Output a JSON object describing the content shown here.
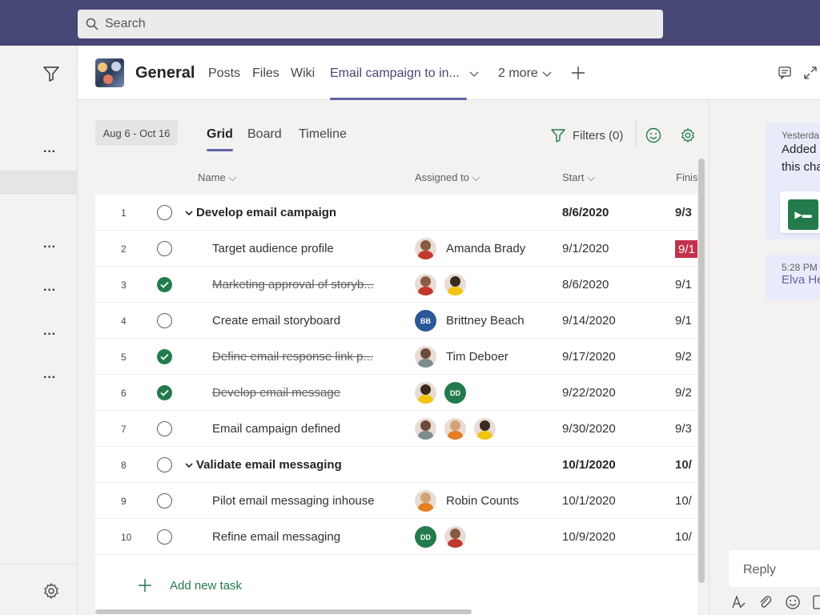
{
  "search": {
    "placeholder": "Search"
  },
  "channel": {
    "name": "General",
    "tabs": [
      "Posts",
      "Files",
      "Wiki",
      "Email campaign to in...",
      "2 more"
    ],
    "active_tab_index": 3
  },
  "planner": {
    "date_range": "Aug 6 - Oct 16",
    "views": [
      "Grid",
      "Board",
      "Timeline"
    ],
    "active_view": "Grid",
    "filters_label": "Filters (0)",
    "columns": {
      "name": "Name",
      "assigned": "Assigned to",
      "start": "Start",
      "finish": "Finis"
    },
    "tasks": [
      {
        "num": "1",
        "status": "open",
        "name": "Develop email campaign",
        "group": true,
        "start": "8/6/2020",
        "finish": "9/3",
        "assignees": []
      },
      {
        "num": "2",
        "status": "open",
        "name": "Target audience profile",
        "group": false,
        "start": "9/1/2020",
        "finish": "9/1",
        "late": true,
        "assignees": [
          {
            "type": "photo",
            "style": "p1"
          }
        ],
        "assignee_name": "Amanda Brady"
      },
      {
        "num": "3",
        "status": "done",
        "name": "Marketing approval of storyb...",
        "group": false,
        "start": "8/6/2020",
        "finish": "9/1",
        "assignees": [
          {
            "type": "photo",
            "style": "p1"
          },
          {
            "type": "photo",
            "style": "p2"
          }
        ]
      },
      {
        "num": "4",
        "status": "open",
        "name": "Create email storyboard",
        "group": false,
        "start": "9/14/2020",
        "finish": "9/1",
        "assignees": [
          {
            "type": "initials",
            "text": "BB",
            "color": "#2b5797"
          }
        ],
        "assignee_name": "Brittney Beach"
      },
      {
        "num": "5",
        "status": "done",
        "name": "Define email response link p...",
        "group": false,
        "start": "9/17/2020",
        "finish": "9/2",
        "assignees": [
          {
            "type": "photo",
            "style": "p3"
          }
        ],
        "assignee_name": "Tim Deboer"
      },
      {
        "num": "6",
        "status": "done",
        "name": "Develop email message",
        "group": false,
        "start": "9/22/2020",
        "finish": "9/2",
        "assignees": [
          {
            "type": "photo",
            "style": "p2"
          },
          {
            "type": "initials",
            "text": "DD",
            "color": "#237b4b"
          }
        ]
      },
      {
        "num": "7",
        "status": "open",
        "name": "Email campaign defined",
        "group": false,
        "start": "9/30/2020",
        "finish": "9/3",
        "assignees": [
          {
            "type": "photo",
            "style": "p3"
          },
          {
            "type": "photo",
            "style": "p4"
          },
          {
            "type": "photo",
            "style": "p2"
          }
        ]
      },
      {
        "num": "8",
        "status": "open",
        "name": "Validate email messaging",
        "group": true,
        "start": "10/1/2020",
        "finish": "10/",
        "assignees": []
      },
      {
        "num": "9",
        "status": "open",
        "name": "Pilot email messaging inhouse",
        "group": false,
        "start": "10/1/2020",
        "finish": "10/",
        "assignees": [
          {
            "type": "photo",
            "style": "p4"
          }
        ],
        "assignee_name": "Robin Counts"
      },
      {
        "num": "10",
        "status": "open",
        "name": "Refine email messaging",
        "group": false,
        "start": "10/9/2020",
        "finish": "10/",
        "assignees": [
          {
            "type": "initials",
            "text": "DD",
            "color": "#237b4b"
          },
          {
            "type": "photo",
            "style": "p1"
          }
        ]
      }
    ],
    "add_task_label": "Add new task"
  },
  "chat": {
    "msg1_time": "Yesterda",
    "msg1_line1": "Added",
    "msg1_line2": "this cha",
    "msg2_time": "5:28 PM",
    "msg2_name": "Elva He",
    "reply_placeholder": "Reply"
  },
  "colors": {
    "brand": "#464775",
    "accent": "#6264a7",
    "done_green": "#237b4b",
    "late_red": "#c4314b"
  },
  "icons": [
    "search-icon",
    "filter-icon",
    "more-icon",
    "gear-icon",
    "chevron-down-icon",
    "plus-icon",
    "checkmark-icon",
    "smiley-icon",
    "conversation-icon",
    "expand-icon",
    "format-icon",
    "attach-icon",
    "emoji-icon",
    "sticker-icon"
  ]
}
